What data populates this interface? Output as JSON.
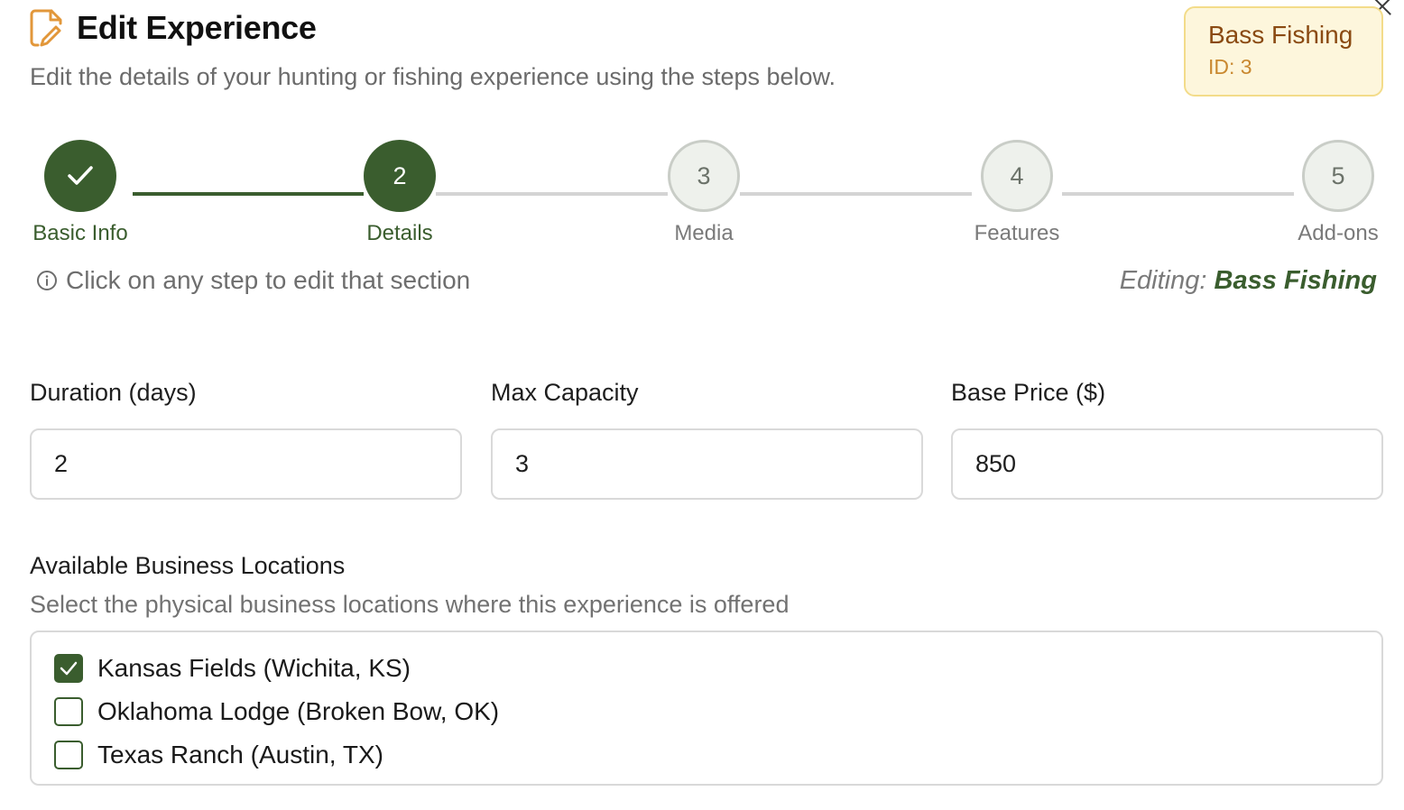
{
  "header": {
    "title": "Edit Experience",
    "subtitle": "Edit the details of your hunting or fishing experience using the steps below."
  },
  "badge": {
    "name": "Bass Fishing",
    "id": "ID: 3"
  },
  "steps": [
    {
      "number": "1",
      "label": "Basic Info",
      "state": "completed"
    },
    {
      "number": "2",
      "label": "Details",
      "state": "active"
    },
    {
      "number": "3",
      "label": "Media",
      "state": "pending"
    },
    {
      "number": "4",
      "label": "Features",
      "state": "pending"
    },
    {
      "number": "5",
      "label": "Add-ons",
      "state": "pending"
    }
  ],
  "hint": "Click on any step to edit that section",
  "editing": {
    "prefix": "Editing:",
    "name": "Bass Fishing"
  },
  "fields": {
    "duration": {
      "label": "Duration (days)",
      "value": "2"
    },
    "capacity": {
      "label": "Max Capacity",
      "value": "3"
    },
    "price": {
      "label": "Base Price ($)",
      "value": "850"
    }
  },
  "locations": {
    "title": "Available Business Locations",
    "subtitle": "Select the physical business locations where this experience is offered",
    "items": [
      {
        "label": "Kansas Fields (Wichita, KS)",
        "checked": true
      },
      {
        "label": "Oklahoma Lodge (Broken Bow, OK)",
        "checked": false
      },
      {
        "label": "Texas Ranch (Austin, TX)",
        "checked": false
      }
    ]
  },
  "colors": {
    "primary_green": "#3a5d2e",
    "badge_bg": "#fdf6dc",
    "badge_text": "#8a4a12",
    "accent_orange": "#e2973a"
  },
  "icons": {
    "title": "file-edit-icon",
    "close": "close-icon",
    "hint": "info-icon",
    "completed_step": "check-icon"
  }
}
